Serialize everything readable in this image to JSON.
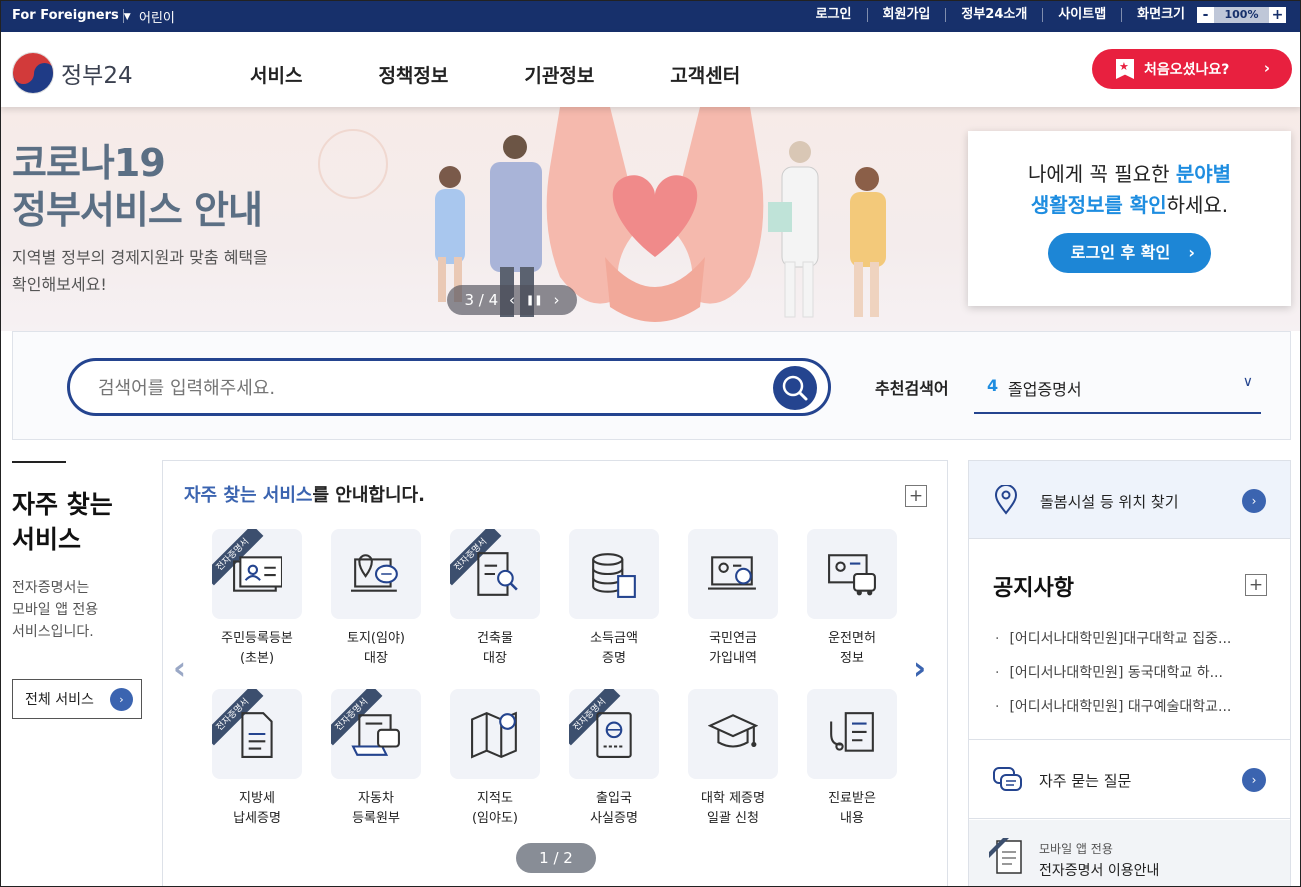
{
  "topbar": {
    "foreigners": "For Foreigners",
    "kids": "어린이",
    "links": [
      "로그인",
      "회원가입",
      "정부24소개",
      "사이트맵",
      "화면크기"
    ],
    "zoom_minus": "-",
    "zoom_value": "100%",
    "zoom_plus": "+"
  },
  "header": {
    "logo_text": "정부24",
    "menu": [
      "서비스",
      "정책정보",
      "기관정보",
      "고객센터"
    ],
    "first_visit": "처음오셨나요?"
  },
  "banner": {
    "title_line1": "코로나19",
    "title_line2": "정부서비스 안내",
    "sub_line1": "지역별 정부의 경제지원과 맞춤 혜택을",
    "sub_line2": "확인해보세요!",
    "pager": "3 / 4",
    "card_line1_a": "나에게 꼭 필요한 ",
    "card_line1_b": "분야별",
    "card_line2_a": "생활정보를 확인",
    "card_line2_b": "하세요.",
    "card_button": "로그인 후 확인"
  },
  "search": {
    "placeholder": "검색어를 입력해주세요.",
    "recommend_label": "추천검색어",
    "recommend_num": "4",
    "recommend_value": "졸업증명서"
  },
  "frequent": {
    "title_line1": "자주 찾는",
    "title_line2": "서비스",
    "desc_line1": "전자증명서는",
    "desc_line2": "모바일 앱 전용",
    "desc_line3": "서비스입니다.",
    "all_button": "전체 서비스",
    "heading_a": "자주 찾는 서비스",
    "heading_b": "를 안내합니다.",
    "ribbon": "전자증명서",
    "items": [
      {
        "l1": "주민등록등본",
        "l2": "(초본)"
      },
      {
        "l1": "토지(임야)",
        "l2": "대장"
      },
      {
        "l1": "건축물",
        "l2": "대장"
      },
      {
        "l1": "소득금액",
        "l2": "증명"
      },
      {
        "l1": "국민연금",
        "l2": "가입내역"
      },
      {
        "l1": "운전면허",
        "l2": "정보"
      },
      {
        "l1": "지방세",
        "l2": "납세증명"
      },
      {
        "l1": "자동차",
        "l2": "등록원부"
      },
      {
        "l1": "지적도",
        "l2": "(임야도)"
      },
      {
        "l1": "출입국",
        "l2": "사실증명"
      },
      {
        "l1": "대학 제증명",
        "l2": "일괄 신청"
      },
      {
        "l1": "진료받은",
        "l2": "내용"
      }
    ],
    "pager": "1 / 2"
  },
  "right": {
    "location": "돌봄시설 등 위치 찾기",
    "notice_title": "공지사항",
    "notices": [
      "[어디서나대학민원]대구대학교 집중...",
      "[어디서나대학민원] 동국대학교 하...",
      "[어디서나대학민원] 대구예술대학교..."
    ],
    "faq": "자주 묻는 질문",
    "mobile_small": "모바일 앱 전용",
    "mobile_main": "전자증명서 이용안내"
  }
}
